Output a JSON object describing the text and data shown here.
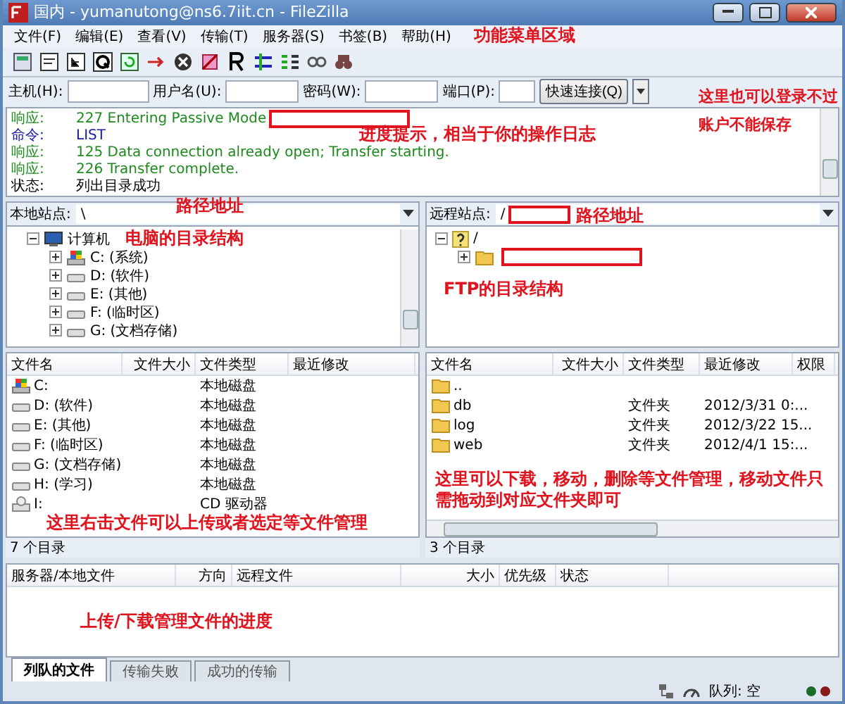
{
  "window": {
    "title": "国内 - yumanutong@ns6.7iit.cn - FileZilla"
  },
  "menu": {
    "items": [
      "文件(F)",
      "编辑(E)",
      "查看(V)",
      "传输(T)",
      "服务器(S)",
      "书签(B)",
      "帮助(H)"
    ],
    "annotation": "功能菜单区域"
  },
  "quickconnect": {
    "host_label": "主机(H):",
    "user_label": "用户名(U):",
    "password_label": "密码(W):",
    "port_label": "端口(P):",
    "button": "快速连接(Q)",
    "annotation": "这里也可以登录不过账户不能保存"
  },
  "log": {
    "entries": [
      {
        "kind": "response",
        "label": "响应:",
        "text": "227 Entering Passive Mode",
        "redacted": true
      },
      {
        "kind": "command",
        "label": "命令:",
        "text": "LIST",
        "redacted": false
      },
      {
        "kind": "response",
        "label": "响应:",
        "text": "125 Data connection already open; Transfer starting.",
        "redacted": false
      },
      {
        "kind": "response",
        "label": "响应:",
        "text": "226 Transfer complete.",
        "redacted": false
      },
      {
        "kind": "status",
        "label": "状态:",
        "text": "列出目录成功",
        "redacted": false
      }
    ],
    "annotation": "进度提示，相当于你的操作日志"
  },
  "local": {
    "path_label": "本地站点:",
    "path": "\\",
    "path_redacted": false,
    "path_annotation": "路径地址",
    "tree": [
      {
        "kind": "computer",
        "name": "计算机",
        "expanded": true,
        "children": [
          {
            "kind": "system-drive",
            "name": "C: (系统)",
            "expanded": false
          },
          {
            "kind": "drive",
            "name": "D: (软件)",
            "expanded": false
          },
          {
            "kind": "drive",
            "name": "E: (其他)",
            "expanded": false
          },
          {
            "kind": "drive",
            "name": "F: (临时区)",
            "expanded": false
          },
          {
            "kind": "drive",
            "name": "G: (文档存储)",
            "expanded": false
          }
        ]
      }
    ],
    "tree_annotation": "电脑的目录结构",
    "columns": [
      "文件名",
      "文件大小",
      "文件类型",
      "最近修改"
    ],
    "rows": [
      {
        "kind": "system-drive",
        "name": "C:",
        "type": "本地磁盘"
      },
      {
        "kind": "drive",
        "name": "D: (软件)",
        "type": "本地磁盘"
      },
      {
        "kind": "drive",
        "name": "E: (其他)",
        "type": "本地磁盘"
      },
      {
        "kind": "drive",
        "name": "F: (临时区)",
        "type": "本地磁盘"
      },
      {
        "kind": "drive",
        "name": "G: (文档存储)",
        "type": "本地磁盘"
      },
      {
        "kind": "drive",
        "name": "H: (学习)",
        "type": "本地磁盘"
      },
      {
        "kind": "cd",
        "name": "I:",
        "type": "CD 驱动器"
      }
    ],
    "list_annotation": "这里右击文件可以上传或者选定等文件管理",
    "status": "7 个目录"
  },
  "remote": {
    "path_label": "远程站点:",
    "path": "/",
    "path_redacted": true,
    "path_annotation": "路径地址",
    "tree": [
      {
        "kind": "unknown",
        "name": "/",
        "expanded": true,
        "children": [
          {
            "kind": "folder",
            "redacted": true,
            "expanded": false
          }
        ]
      }
    ],
    "tree_annotation": "FTP的目录结构",
    "columns": [
      "文件名",
      "文件大小",
      "文件类型",
      "最近修改",
      "权限"
    ],
    "rows": [
      {
        "kind": "folder",
        "name": ".."
      },
      {
        "kind": "folder",
        "name": "db",
        "type": "文件夹",
        "modified": "2012/3/31 0:..."
      },
      {
        "kind": "folder",
        "name": "log",
        "type": "文件夹",
        "modified": "2012/3/22 15..."
      },
      {
        "kind": "folder",
        "name": "web",
        "type": "文件夹",
        "modified": "2012/4/1 15:..."
      }
    ],
    "list_annotation": "这里可以下载，移动，删除等文件管理，移动文件只需拖动到对应文件夹即可",
    "status": "3 个目录"
  },
  "queue": {
    "columns": [
      "服务器/本地文件",
      "方向",
      "远程文件",
      "大小",
      "优先级",
      "状态"
    ],
    "annotation": "上传/下载管理文件的进度"
  },
  "tabs": [
    {
      "label": "列队的文件",
      "selected": true
    },
    {
      "label": "传输失败",
      "selected": false
    },
    {
      "label": "成功的传输",
      "selected": false
    }
  ],
  "status_bar": {
    "queue": "队列: 空"
  }
}
